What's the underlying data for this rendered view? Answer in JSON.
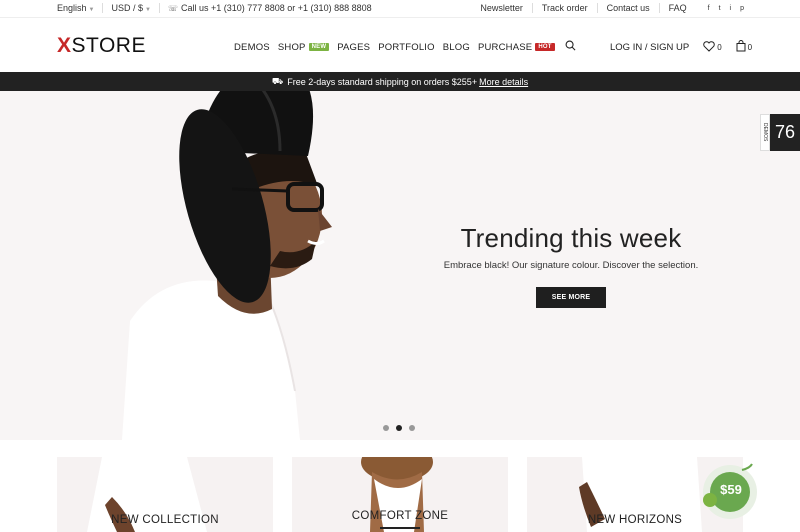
{
  "topbar": {
    "language": "English",
    "currency": "USD / $",
    "phone": "Call us +1 (310) 777 8808 or +1 (310) 888 8808",
    "links": [
      "Newsletter",
      "Track order",
      "Contact us",
      "FAQ"
    ],
    "socials": [
      "f",
      "t",
      "i",
      "p"
    ]
  },
  "header": {
    "logo_mark": "X",
    "logo_text": "STORE",
    "nav": {
      "demos": "DEMOS",
      "shop": "SHOP",
      "shop_badge": "NEW",
      "pages": "PAGES",
      "portfolio": "PORTFOLIO",
      "blog": "BLOG",
      "purchase": "PURCHASE",
      "purchase_badge": "HOT"
    },
    "account": "LOG IN / SIGN UP",
    "wishlist_count": "0",
    "cart_count": "0"
  },
  "promo": {
    "text": "Free 2-days standard shipping on orders $255+",
    "link": "More details"
  },
  "hero": {
    "title": "Trending this week",
    "subtitle": "Embrace black! Our signature colour. Discover the selection.",
    "button": "SEE MORE",
    "slides": 3,
    "active_slide": 2
  },
  "demos_tab": {
    "label": "DEMOS",
    "count": "76"
  },
  "tiles": [
    {
      "caption": "NEW COLLECTION"
    },
    {
      "caption": "COMFORT ZONE"
    },
    {
      "caption": "NEW HORIZONS"
    }
  ],
  "price_badge": {
    "text": "$59"
  },
  "colors": {
    "accent_red": "#c62828",
    "badge_green": "#7cb342",
    "dark": "#1f1f1f",
    "hero_bg": "#f8f5f5",
    "price_green": "#6aa84f"
  }
}
